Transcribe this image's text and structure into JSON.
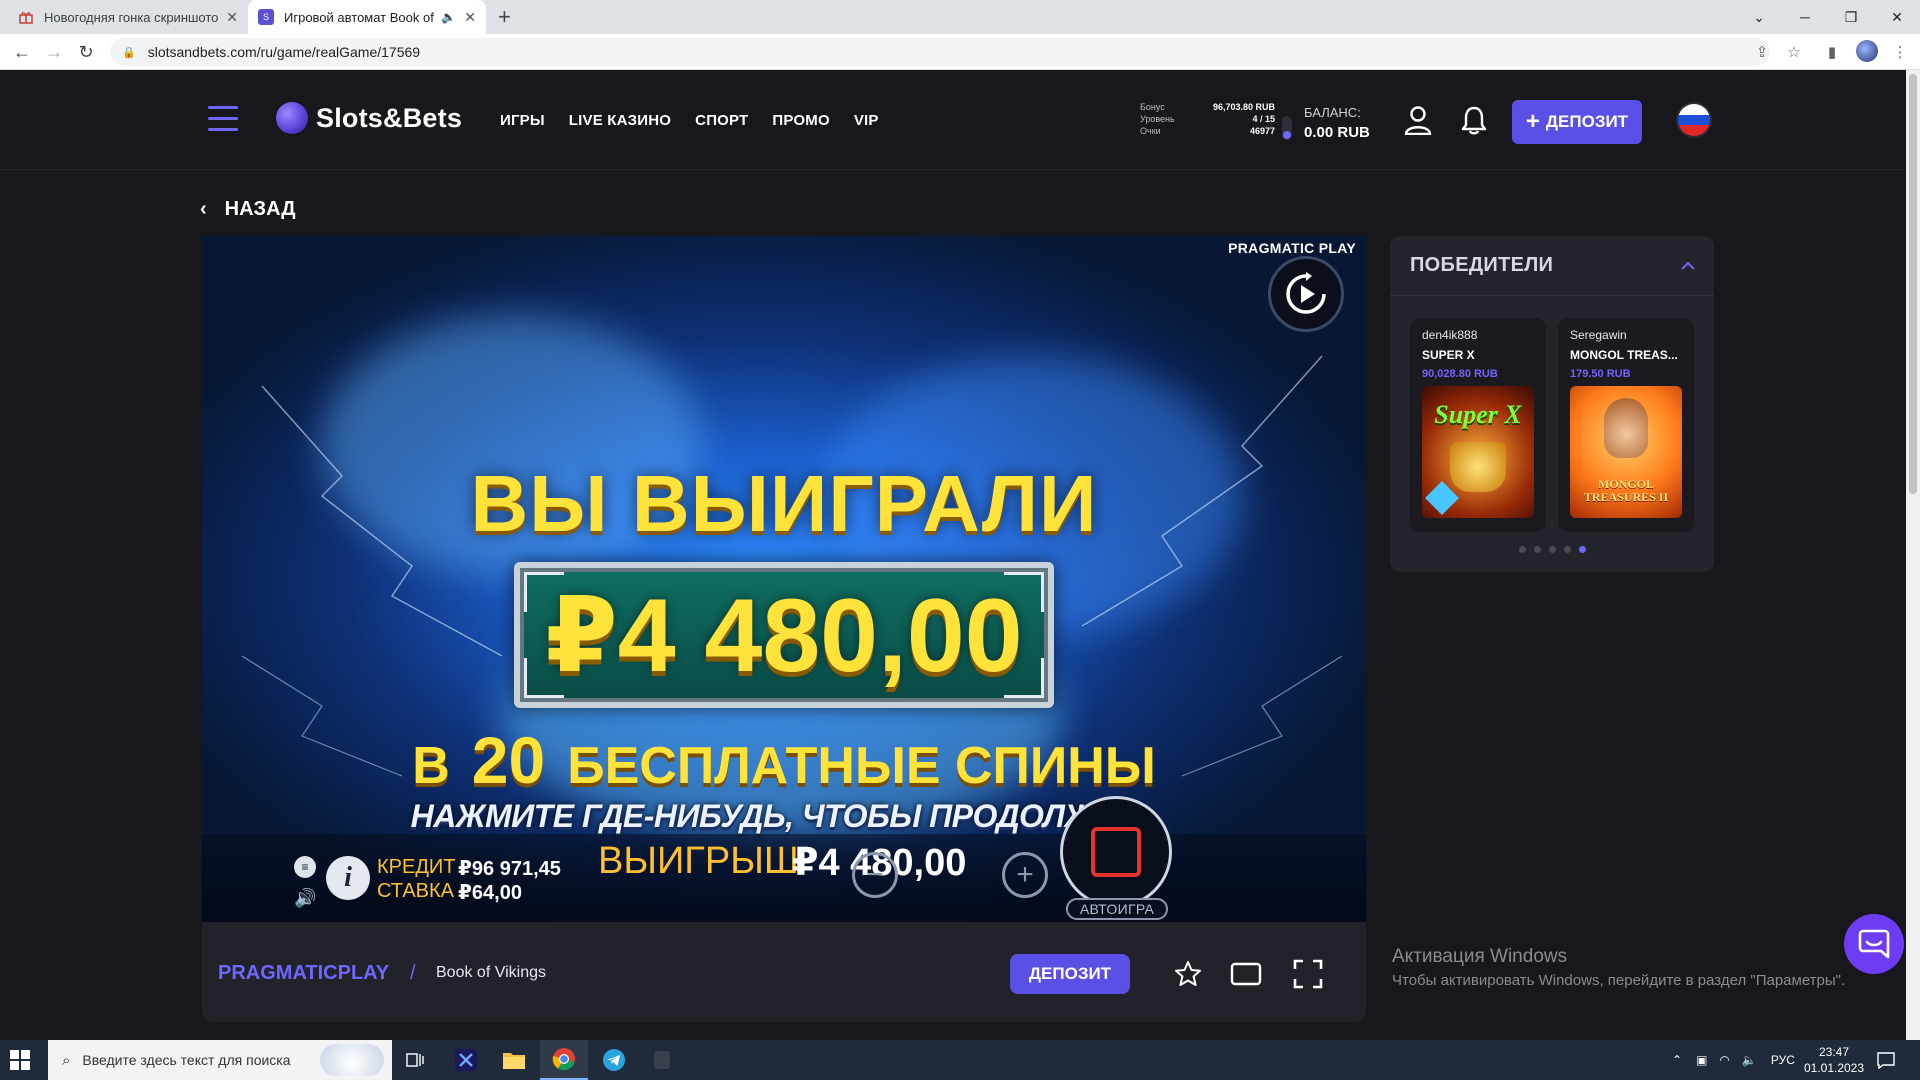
{
  "browser": {
    "tabs": [
      {
        "title": "Новогодняя гонка скриншотов",
        "active": false
      },
      {
        "title": "Игровой автомат Book of Vikings",
        "active": true
      }
    ],
    "new_tab": "+",
    "url": "slotsandbets.com/ru/game/realGame/17569"
  },
  "site": {
    "logo": "Slots&Bets",
    "nav": [
      "ИГРЫ",
      "LIVE КАЗИНО",
      "СПОРТ",
      "ПРОМО",
      "VIP"
    ],
    "bonus": {
      "labels": [
        "Бонус",
        "Уровень",
        "Очки"
      ],
      "values": [
        "96,703.80 RUB",
        "4 / 15",
        "46977"
      ]
    },
    "balance_label": "БАЛАНС:",
    "balance_value": "0.00 RUB",
    "deposit_label": "ДЕПОЗИТ",
    "back_label": "НАЗАД"
  },
  "game": {
    "provider_top": "PRAGMATIC PLAY",
    "win_title": "ВЫ ВЫИГРАЛИ",
    "win_amount": "₽4 480,00",
    "spins_prefix": "В",
    "spins_count": "20",
    "spins_suffix": "БЕСПЛАТНЫЕ СПИНЫ",
    "continue_text": "НАЖМИТЕ ГДЕ-НИБУДЬ, ЧТОБЫ ПРОДОЛЖИТЬ",
    "credit_label": "КРЕДИТ",
    "credit_value": "₽96 971,45",
    "bet_label": "СТАВКА",
    "bet_value": "₽64,00",
    "win_label": "ВЫИГРЫШ",
    "win_value": "₽4 480,00",
    "autoplay_label": "АВТОИГРА",
    "minus": "−",
    "plus": "+"
  },
  "gamebar": {
    "provider": "PRAGMATICPLAY",
    "separator": "/",
    "game_name": "Book of Vikings",
    "deposit_label": "ДЕПОЗИТ"
  },
  "winners": {
    "title": "ПОБЕДИТЕЛИ",
    "cards": [
      {
        "user": "den4ik888",
        "game": "SUPER X",
        "prize": "90,028.80 RUB",
        "thumb_caption": "Super X"
      },
      {
        "user": "Seregawin",
        "game": "MONGOL TREAS...",
        "prize": "179.50 RUB",
        "thumb_caption": "MONGOL TREASURES II"
      }
    ],
    "dots_total": 5,
    "dots_active": 5
  },
  "activation": {
    "line1": "Активация Windows",
    "line2": "Чтобы активировать Windows, перейдите в раздел \"Параметры\"."
  },
  "taskbar": {
    "search_placeholder": "Введите здесь текст для поиска",
    "lang": "РУС",
    "time": "23:47",
    "date": "01.01.2023"
  },
  "colors": {
    "accent": "#5b50e6",
    "accent_text": "#6f66ff",
    "gold": "#ffe23a",
    "bg": "#17171c"
  }
}
